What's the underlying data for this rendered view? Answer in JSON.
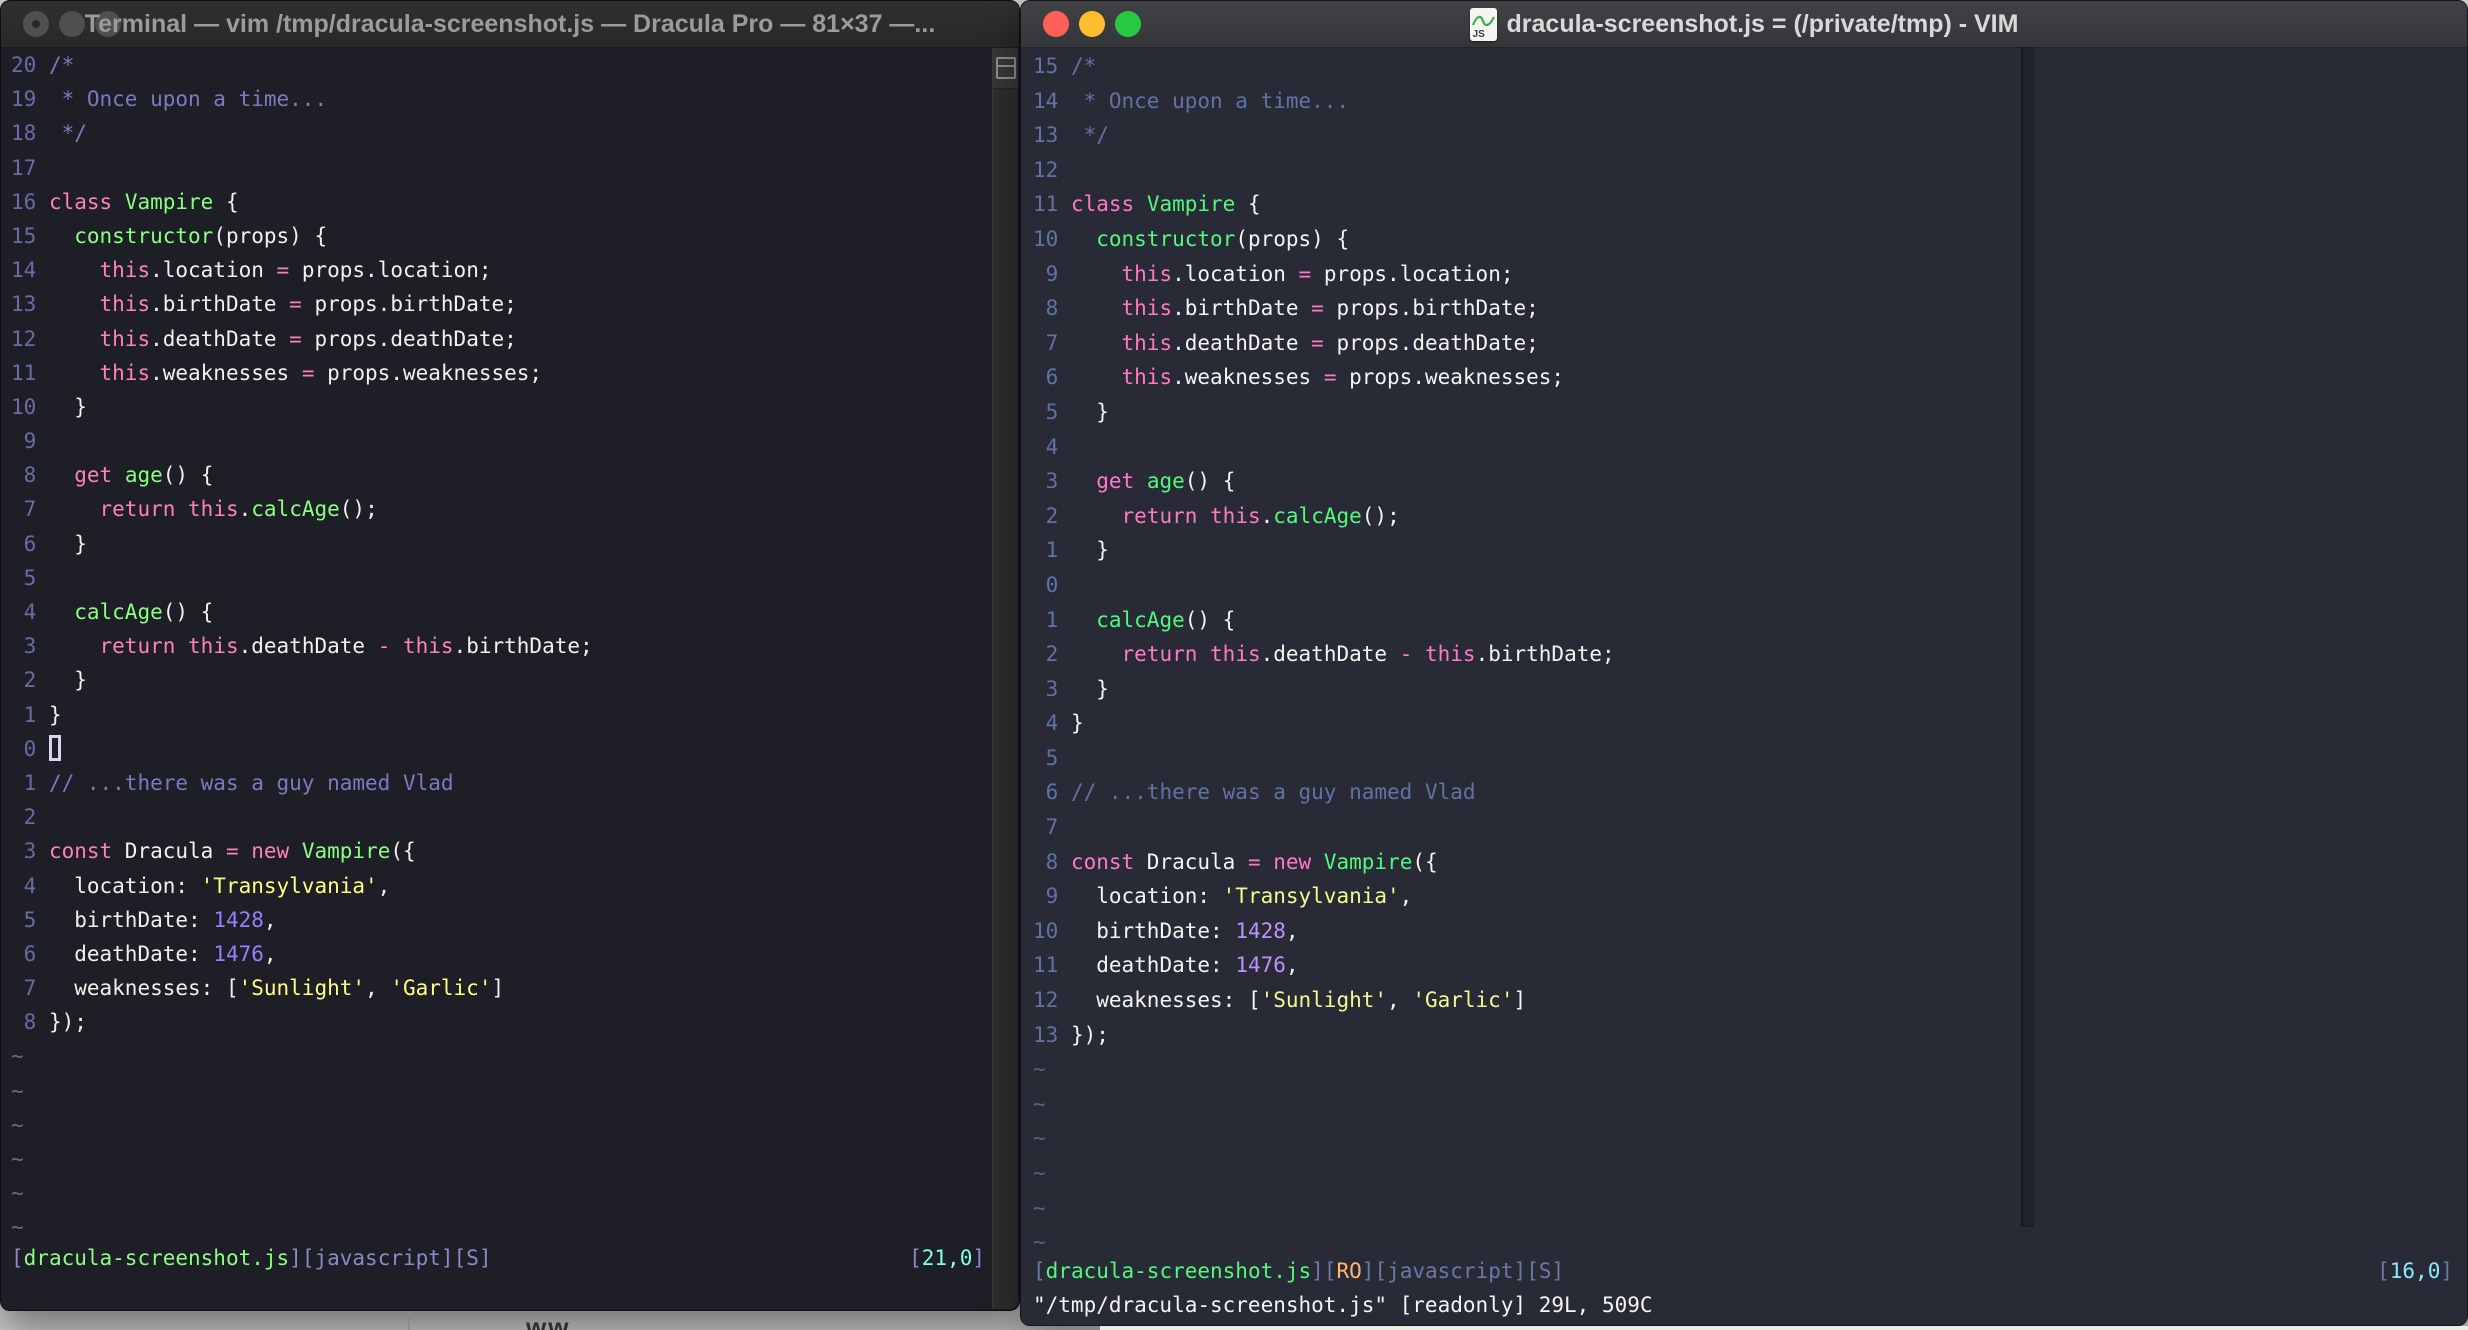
{
  "code_rows": [
    {
      "segs": [
        [
          "/*",
          "comment"
        ]
      ]
    },
    {
      "segs": [
        [
          " * Once upon a time...",
          "comment"
        ]
      ]
    },
    {
      "segs": [
        [
          " */",
          "comment"
        ]
      ]
    },
    {
      "segs": []
    },
    {
      "segs": [
        [
          "class",
          "pink"
        ],
        [
          " ",
          "fg"
        ],
        [
          "Vampire",
          "green"
        ],
        [
          " {",
          "fg"
        ]
      ]
    },
    {
      "segs": [
        [
          "  ",
          "fg"
        ],
        [
          "constructor",
          "green"
        ],
        [
          "(props) {",
          "fg"
        ]
      ]
    },
    {
      "segs": [
        [
          "    ",
          "fg"
        ],
        [
          "this",
          "pink"
        ],
        [
          ".location ",
          "fg"
        ],
        [
          "=",
          "pink"
        ],
        [
          " props.location;",
          "fg"
        ]
      ]
    },
    {
      "segs": [
        [
          "    ",
          "fg"
        ],
        [
          "this",
          "pink"
        ],
        [
          ".birthDate ",
          "fg"
        ],
        [
          "=",
          "pink"
        ],
        [
          " props.birthDate;",
          "fg"
        ]
      ]
    },
    {
      "segs": [
        [
          "    ",
          "fg"
        ],
        [
          "this",
          "pink"
        ],
        [
          ".deathDate ",
          "fg"
        ],
        [
          "=",
          "pink"
        ],
        [
          " props.deathDate;",
          "fg"
        ]
      ]
    },
    {
      "segs": [
        [
          "    ",
          "fg"
        ],
        [
          "this",
          "pink"
        ],
        [
          ".weaknesses ",
          "fg"
        ],
        [
          "=",
          "pink"
        ],
        [
          " props.weaknesses;",
          "fg"
        ]
      ]
    },
    {
      "segs": [
        [
          "  }",
          "fg"
        ]
      ]
    },
    {
      "segs": []
    },
    {
      "segs": [
        [
          "  ",
          "fg"
        ],
        [
          "get",
          "pink"
        ],
        [
          " ",
          "fg"
        ],
        [
          "age",
          "green"
        ],
        [
          "() {",
          "fg"
        ]
      ]
    },
    {
      "segs": [
        [
          "    ",
          "fg"
        ],
        [
          "return",
          "pink"
        ],
        [
          " ",
          "fg"
        ],
        [
          "this",
          "pink"
        ],
        [
          ".",
          "fg"
        ],
        [
          "calcAge",
          "green"
        ],
        [
          "();",
          "fg"
        ]
      ]
    },
    {
      "segs": [
        [
          "  }",
          "fg"
        ]
      ]
    },
    {
      "segs": []
    },
    {
      "segs": [
        [
          "  ",
          "fg"
        ],
        [
          "calcAge",
          "green"
        ],
        [
          "() {",
          "fg"
        ]
      ]
    },
    {
      "segs": [
        [
          "    ",
          "fg"
        ],
        [
          "return",
          "pink"
        ],
        [
          " ",
          "fg"
        ],
        [
          "this",
          "pink"
        ],
        [
          ".deathDate ",
          "fg"
        ],
        [
          "-",
          "pink"
        ],
        [
          " ",
          "fg"
        ],
        [
          "this",
          "pink"
        ],
        [
          ".birthDate;",
          "fg"
        ]
      ]
    },
    {
      "segs": [
        [
          "  }",
          "fg"
        ]
      ]
    },
    {
      "segs": [
        [
          "}",
          "fg"
        ]
      ]
    },
    {
      "segs": [],
      "cursor_line": true
    },
    {
      "segs": [
        [
          "// ...there was a guy named Vlad",
          "comment"
        ]
      ]
    },
    {
      "segs": []
    },
    {
      "segs": [
        [
          "const",
          "pink"
        ],
        [
          " Dracula ",
          "fg"
        ],
        [
          "=",
          "pink"
        ],
        [
          " ",
          "fg"
        ],
        [
          "new",
          "pink"
        ],
        [
          " ",
          "fg"
        ],
        [
          "Vampire",
          "green"
        ],
        [
          "({",
          "fg"
        ]
      ]
    },
    {
      "segs": [
        [
          "  location: ",
          "fg"
        ],
        [
          "'Transylvania'",
          "yellow"
        ],
        [
          ",",
          "fg"
        ]
      ]
    },
    {
      "segs": [
        [
          "  birthDate: ",
          "fg"
        ],
        [
          "1428",
          "purple"
        ],
        [
          ",",
          "fg"
        ]
      ]
    },
    {
      "segs": [
        [
          "  deathDate: ",
          "fg"
        ],
        [
          "1476",
          "purple"
        ],
        [
          ",",
          "fg"
        ]
      ]
    },
    {
      "segs": [
        [
          "  weaknesses: [",
          "fg"
        ],
        [
          "'Sunlight'",
          "yellow"
        ],
        [
          ", ",
          "fg"
        ],
        [
          "'Garlic'",
          "yellow"
        ],
        [
          "]",
          "fg"
        ]
      ]
    },
    {
      "segs": [
        [
          "});",
          "fg"
        ]
      ]
    }
  ],
  "left_window": {
    "titlebar": {
      "title": "Terminal — vim /tmp/dracula-screenshot.js — Dracula Pro — 81×37 —...",
      "lights": [
        "close",
        "minimize",
        "zoom"
      ]
    },
    "rel_numbers": [
      "20",
      "19",
      "18",
      "17",
      "16",
      "15",
      "14",
      "13",
      "12",
      "11",
      "10",
      "9",
      "8",
      "7",
      "6",
      "5",
      "4",
      "3",
      "2",
      "1",
      "0",
      "1",
      "2",
      "3",
      "4",
      "5",
      "6",
      "7",
      "8"
    ],
    "tilde_count": 6,
    "show_cursor": true,
    "palette": {
      "bg": "#1d1e26",
      "fg": "#f2f1ec",
      "pink": "#ff80bf",
      "green": "#8aff80",
      "yellow": "#ffff80",
      "purple": "#9580ff",
      "comment": "#7e79c0",
      "num": "#6e69a8",
      "cyan": "#80ffea",
      "lav": "#8d88cc",
      "tilde": "#6d6c75",
      "orange": "#ffb86c"
    },
    "status_left": [
      [
        "[",
        "lav"
      ],
      [
        "dracula-screenshot.js",
        "green"
      ],
      [
        "]",
        "lav"
      ],
      [
        "[",
        "lav"
      ],
      [
        "javascript",
        "lav"
      ],
      [
        "]",
        "lav"
      ],
      [
        "[",
        "lav"
      ],
      [
        "S",
        "lav"
      ],
      [
        "]",
        "lav"
      ]
    ],
    "status_right": [
      [
        "[",
        "lav"
      ],
      [
        "21,0",
        "cyan"
      ],
      [
        "]",
        "lav"
      ]
    ]
  },
  "right_window": {
    "titlebar": {
      "title": "dracula-screenshot.js = (/private/tmp) - VIM",
      "doc_icon_label": "JS",
      "lights": [
        "close",
        "minimize",
        "zoom"
      ]
    },
    "rel_numbers": [
      "15",
      "14",
      "13",
      "12",
      "11",
      "10",
      "9",
      "8",
      "7",
      "6",
      "5",
      "4",
      "3",
      "2",
      "1",
      "0",
      "1",
      "2",
      "3",
      "4",
      "5",
      "6",
      "7",
      "8",
      "9",
      "10",
      "11",
      "12",
      "13"
    ],
    "tilde_count": 6,
    "show_cursor": false,
    "palette": {
      "bg": "#282a36",
      "fg": "#f4f4f0",
      "pink": "#ff79c6",
      "green": "#50fa7b",
      "yellow": "#f1fa8c",
      "purple": "#bd93f9",
      "comment": "#6272a4",
      "num": "#6272a4",
      "cyan": "#8be9fd",
      "lav": "#6b79a8",
      "tilde": "#586180",
      "orange": "#ffb86c"
    },
    "status_left": [
      [
        "[",
        "lav"
      ],
      [
        "dracula-screenshot.js",
        "green"
      ],
      [
        "]",
        "lav"
      ],
      [
        "[",
        "lav"
      ],
      [
        "RO",
        "orange"
      ],
      [
        "]",
        "lav"
      ],
      [
        "[",
        "lav"
      ],
      [
        "javascript",
        "lav"
      ],
      [
        "]",
        "lav"
      ],
      [
        "[",
        "lav"
      ],
      [
        "S",
        "lav"
      ],
      [
        "]",
        "lav"
      ]
    ],
    "status_right": [
      [
        "[",
        "lav"
      ],
      [
        "16,0",
        "cyan"
      ],
      [
        "]",
        "lav"
      ]
    ],
    "command_line": "\"/tmp/dracula-screenshot.js\" [readonly] 29L, 509C"
  }
}
